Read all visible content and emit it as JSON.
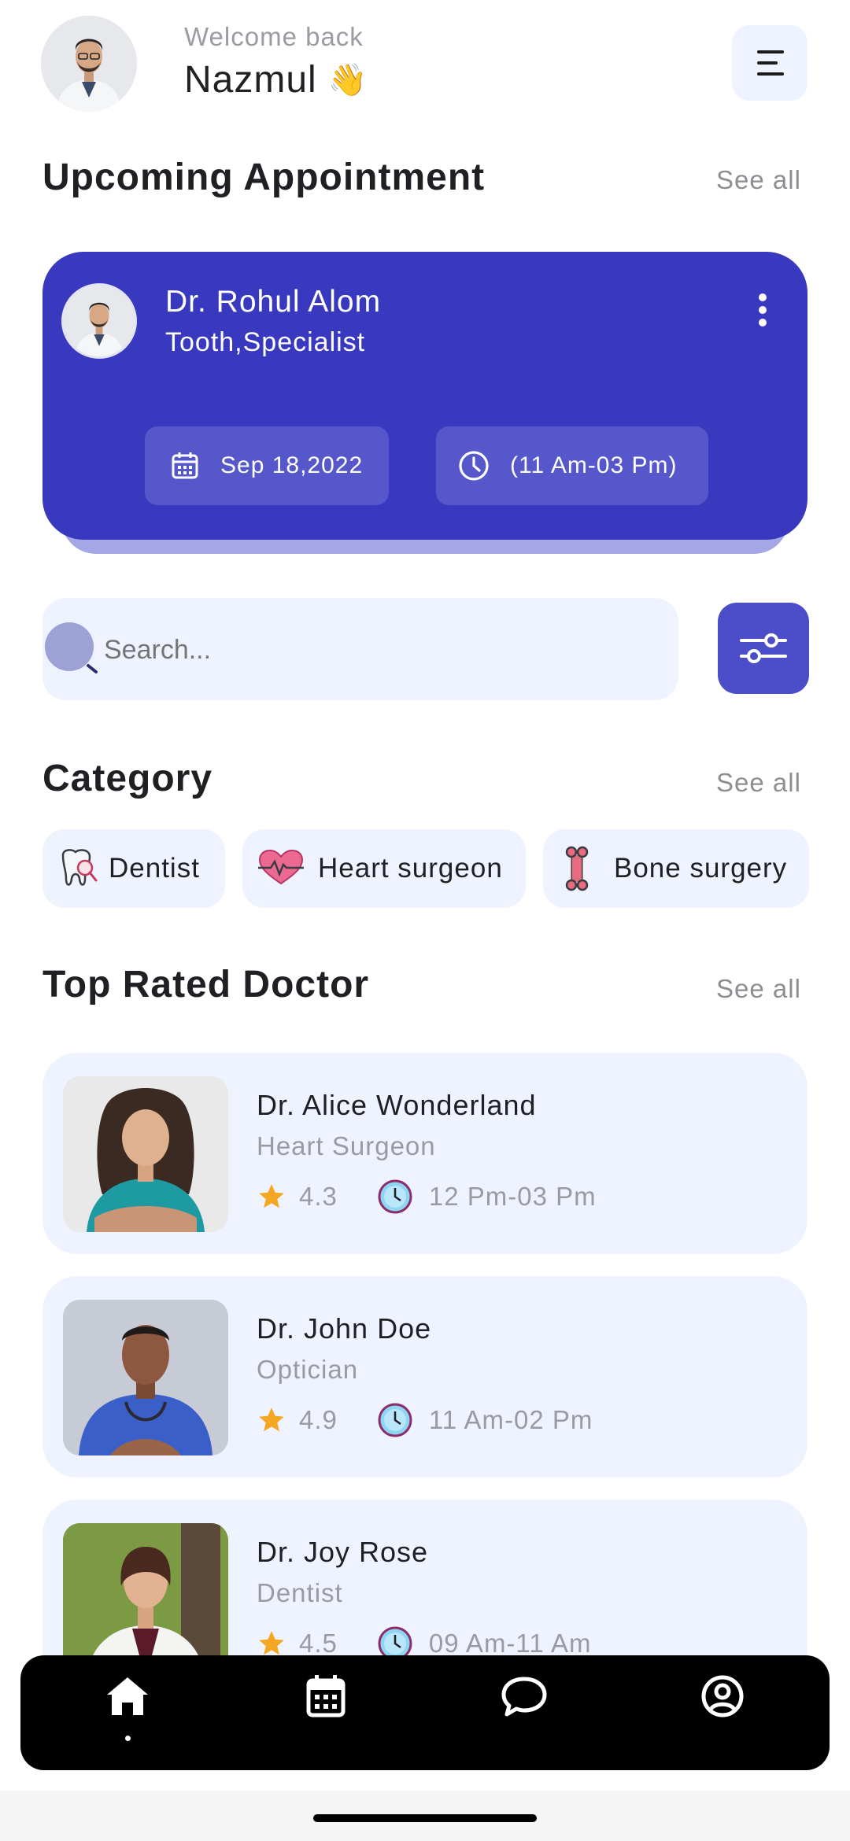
{
  "header": {
    "greeting": "Welcome back",
    "user_name": "Nazmul",
    "wave_emoji": "👋"
  },
  "upcoming": {
    "title": "Upcoming Appointment",
    "see_all": "See all",
    "doctor_name": "Dr. Rohul Alom",
    "specialty": "Tooth,Specialist",
    "date": "Sep 18,2022",
    "time": "(11 Am-03 Pm)"
  },
  "search": {
    "placeholder": "Search..."
  },
  "category": {
    "title": "Category",
    "see_all": "See all",
    "items": [
      {
        "label": "Dentist",
        "icon": "tooth-icon"
      },
      {
        "label": "Heart surgeon",
        "icon": "heart-pulse-icon"
      },
      {
        "label": "Bone surgery",
        "icon": "bone-icon"
      }
    ]
  },
  "top_rated": {
    "title": "Top Rated Doctor",
    "see_all": "See all",
    "doctors": [
      {
        "name": "Dr. Alice Wonderland",
        "specialty": "Heart Surgeon",
        "rating": "4.3",
        "hours": "12 Pm-03 Pm"
      },
      {
        "name": "Dr. John Doe",
        "specialty": "Optician",
        "rating": "4.9",
        "hours": "11 Am-02 Pm"
      },
      {
        "name": "Dr. Joy Rose",
        "specialty": "Dentist",
        "rating": "4.5",
        "hours": "09 Am-11 Am"
      }
    ]
  },
  "bottom_nav": {
    "items": [
      "home-icon",
      "calendar-icon",
      "chat-icon",
      "profile-icon"
    ],
    "active": "home-icon"
  },
  "colors": {
    "primary": "#3839be",
    "card_bg": "#eff3ff",
    "star": "#f5a623"
  }
}
